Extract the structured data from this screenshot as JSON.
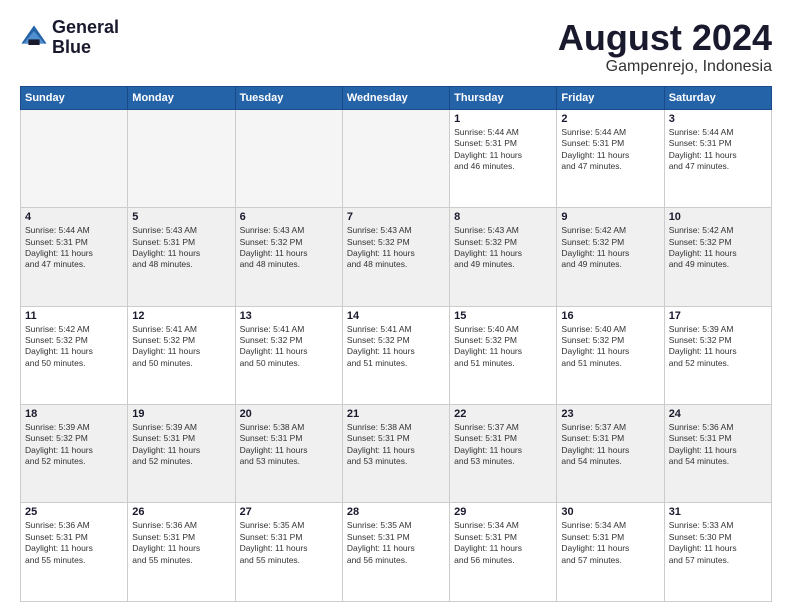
{
  "header": {
    "logo_line1": "General",
    "logo_line2": "Blue",
    "month_year": "August 2024",
    "location": "Gampenrejo, Indonesia"
  },
  "weekdays": [
    "Sunday",
    "Monday",
    "Tuesday",
    "Wednesday",
    "Thursday",
    "Friday",
    "Saturday"
  ],
  "weeks": [
    [
      {
        "day": "",
        "empty": true
      },
      {
        "day": "",
        "empty": true
      },
      {
        "day": "",
        "empty": true
      },
      {
        "day": "",
        "empty": true
      },
      {
        "day": "1",
        "info": "Sunrise: 5:44 AM\nSunset: 5:31 PM\nDaylight: 11 hours\nand 46 minutes."
      },
      {
        "day": "2",
        "info": "Sunrise: 5:44 AM\nSunset: 5:31 PM\nDaylight: 11 hours\nand 47 minutes."
      },
      {
        "day": "3",
        "info": "Sunrise: 5:44 AM\nSunset: 5:31 PM\nDaylight: 11 hours\nand 47 minutes."
      }
    ],
    [
      {
        "day": "4",
        "shaded": true,
        "info": "Sunrise: 5:44 AM\nSunset: 5:31 PM\nDaylight: 11 hours\nand 47 minutes."
      },
      {
        "day": "5",
        "shaded": true,
        "info": "Sunrise: 5:43 AM\nSunset: 5:31 PM\nDaylight: 11 hours\nand 48 minutes."
      },
      {
        "day": "6",
        "shaded": true,
        "info": "Sunrise: 5:43 AM\nSunset: 5:32 PM\nDaylight: 11 hours\nand 48 minutes."
      },
      {
        "day": "7",
        "shaded": true,
        "info": "Sunrise: 5:43 AM\nSunset: 5:32 PM\nDaylight: 11 hours\nand 48 minutes."
      },
      {
        "day": "8",
        "shaded": true,
        "info": "Sunrise: 5:43 AM\nSunset: 5:32 PM\nDaylight: 11 hours\nand 49 minutes."
      },
      {
        "day": "9",
        "shaded": true,
        "info": "Sunrise: 5:42 AM\nSunset: 5:32 PM\nDaylight: 11 hours\nand 49 minutes."
      },
      {
        "day": "10",
        "shaded": true,
        "info": "Sunrise: 5:42 AM\nSunset: 5:32 PM\nDaylight: 11 hours\nand 49 minutes."
      }
    ],
    [
      {
        "day": "11",
        "info": "Sunrise: 5:42 AM\nSunset: 5:32 PM\nDaylight: 11 hours\nand 50 minutes."
      },
      {
        "day": "12",
        "info": "Sunrise: 5:41 AM\nSunset: 5:32 PM\nDaylight: 11 hours\nand 50 minutes."
      },
      {
        "day": "13",
        "info": "Sunrise: 5:41 AM\nSunset: 5:32 PM\nDaylight: 11 hours\nand 50 minutes."
      },
      {
        "day": "14",
        "info": "Sunrise: 5:41 AM\nSunset: 5:32 PM\nDaylight: 11 hours\nand 51 minutes."
      },
      {
        "day": "15",
        "info": "Sunrise: 5:40 AM\nSunset: 5:32 PM\nDaylight: 11 hours\nand 51 minutes."
      },
      {
        "day": "16",
        "info": "Sunrise: 5:40 AM\nSunset: 5:32 PM\nDaylight: 11 hours\nand 51 minutes."
      },
      {
        "day": "17",
        "info": "Sunrise: 5:39 AM\nSunset: 5:32 PM\nDaylight: 11 hours\nand 52 minutes."
      }
    ],
    [
      {
        "day": "18",
        "shaded": true,
        "info": "Sunrise: 5:39 AM\nSunset: 5:32 PM\nDaylight: 11 hours\nand 52 minutes."
      },
      {
        "day": "19",
        "shaded": true,
        "info": "Sunrise: 5:39 AM\nSunset: 5:31 PM\nDaylight: 11 hours\nand 52 minutes."
      },
      {
        "day": "20",
        "shaded": true,
        "info": "Sunrise: 5:38 AM\nSunset: 5:31 PM\nDaylight: 11 hours\nand 53 minutes."
      },
      {
        "day": "21",
        "shaded": true,
        "info": "Sunrise: 5:38 AM\nSunset: 5:31 PM\nDaylight: 11 hours\nand 53 minutes."
      },
      {
        "day": "22",
        "shaded": true,
        "info": "Sunrise: 5:37 AM\nSunset: 5:31 PM\nDaylight: 11 hours\nand 53 minutes."
      },
      {
        "day": "23",
        "shaded": true,
        "info": "Sunrise: 5:37 AM\nSunset: 5:31 PM\nDaylight: 11 hours\nand 54 minutes."
      },
      {
        "day": "24",
        "shaded": true,
        "info": "Sunrise: 5:36 AM\nSunset: 5:31 PM\nDaylight: 11 hours\nand 54 minutes."
      }
    ],
    [
      {
        "day": "25",
        "info": "Sunrise: 5:36 AM\nSunset: 5:31 PM\nDaylight: 11 hours\nand 55 minutes."
      },
      {
        "day": "26",
        "info": "Sunrise: 5:36 AM\nSunset: 5:31 PM\nDaylight: 11 hours\nand 55 minutes."
      },
      {
        "day": "27",
        "info": "Sunrise: 5:35 AM\nSunset: 5:31 PM\nDaylight: 11 hours\nand 55 minutes."
      },
      {
        "day": "28",
        "info": "Sunrise: 5:35 AM\nSunset: 5:31 PM\nDaylight: 11 hours\nand 56 minutes."
      },
      {
        "day": "29",
        "info": "Sunrise: 5:34 AM\nSunset: 5:31 PM\nDaylight: 11 hours\nand 56 minutes."
      },
      {
        "day": "30",
        "info": "Sunrise: 5:34 AM\nSunset: 5:31 PM\nDaylight: 11 hours\nand 57 minutes."
      },
      {
        "day": "31",
        "info": "Sunrise: 5:33 AM\nSunset: 5:30 PM\nDaylight: 11 hours\nand 57 minutes."
      }
    ]
  ]
}
